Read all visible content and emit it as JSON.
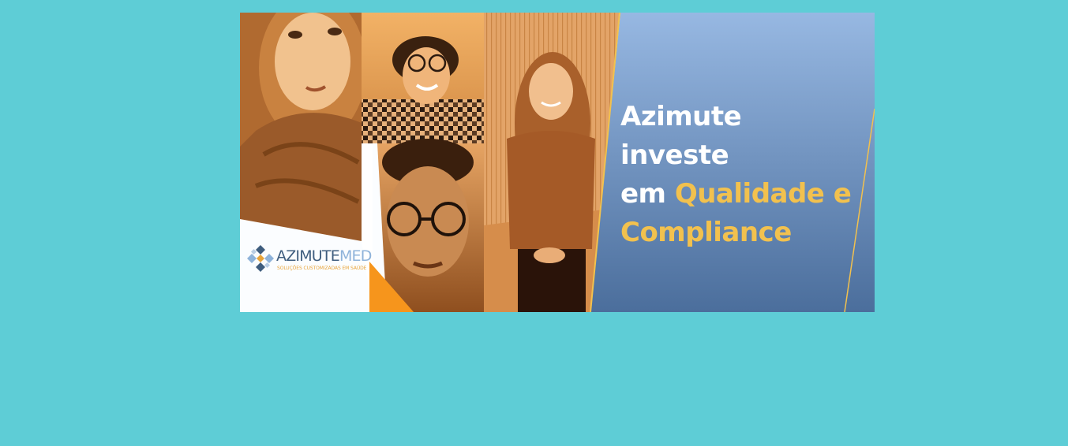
{
  "banner": {
    "headline": {
      "line1": "Azimute investe",
      "line2_prefix": "em ",
      "line2_accent": "Qualidade e",
      "line3_accent": "Compliance"
    },
    "logo": {
      "word_primary": "AZIMUTE",
      "word_secondary": "MED",
      "tagline": "SOLUÇÕES CUSTOMIZADAS EM SAÚDE"
    },
    "photos": [
      "woman-with-long-hair-photo",
      "man-with-curly-hair-and-glasses-photo",
      "man-with-round-glasses-photo",
      "woman-standing-photo"
    ]
  },
  "colors": {
    "page_background": "#5ecdd6",
    "accent_yellow": "#f2c14e",
    "panel_blue_top": "#94b6e1",
    "panel_blue_bottom": "#4a6d9c",
    "photo_orange": "#d98a3e",
    "logo_dark": "#3f5d7e",
    "logo_light": "#8fb3da"
  }
}
